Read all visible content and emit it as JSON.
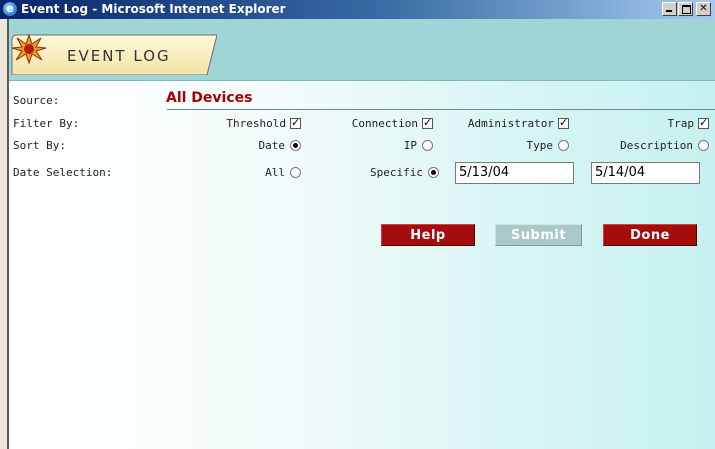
{
  "window": {
    "title": "Event Log - Microsoft Internet Explorer",
    "icon": "ie-icon",
    "controls": [
      "minimize-icon",
      "maximize-icon",
      "close-icon"
    ]
  },
  "header": {
    "tab_label": "EVENT LOG",
    "logo": "starburst-icon"
  },
  "form": {
    "source": {
      "label": "Source:",
      "value": "All Devices"
    },
    "filter_by": {
      "label": "Filter By:",
      "options": [
        {
          "label": "Threshold",
          "checked": true
        },
        {
          "label": "Connection",
          "checked": true
        },
        {
          "label": "Administrator",
          "checked": true
        },
        {
          "label": "Trap",
          "checked": true
        }
      ]
    },
    "sort_by": {
      "label": "Sort By:",
      "options": [
        {
          "label": "Date",
          "selected": true
        },
        {
          "label": "IP",
          "selected": false
        },
        {
          "label": "Type",
          "selected": false
        },
        {
          "label": "Description",
          "selected": false
        }
      ]
    },
    "date_selection": {
      "label": "Date Selection:",
      "options": [
        {
          "label": "All",
          "selected": false
        },
        {
          "label": "Specific",
          "selected": true
        }
      ],
      "from_date": "5/13/04",
      "to_date": "5/14/04"
    }
  },
  "buttons": {
    "help": "Help",
    "submit": "Submit",
    "done": "Done"
  },
  "colors": {
    "accent_red": "#a50c0c",
    "header_band": "#9fd6d5",
    "source_value": "#a80000"
  }
}
